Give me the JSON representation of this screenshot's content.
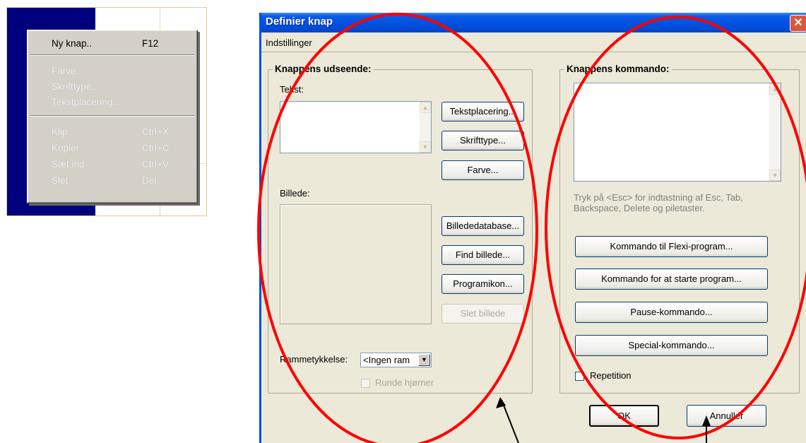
{
  "context_menu": {
    "items": [
      {
        "label": "Ny knap..",
        "accel": "F12",
        "enabled": true
      },
      {
        "label": "Farve...",
        "accel": "",
        "enabled": false
      },
      {
        "label": "Skrifttype...",
        "accel": "",
        "enabled": false
      },
      {
        "label": "Tekstplacering...",
        "accel": "",
        "enabled": false
      },
      {
        "label": "Klip",
        "accel": "Ctrl+X",
        "enabled": false
      },
      {
        "label": "Kopier",
        "accel": "Ctrl+C",
        "enabled": false
      },
      {
        "label": "Sæt ind",
        "accel": "Ctrl+V",
        "enabled": false
      },
      {
        "label": "Slet",
        "accel": "Del",
        "enabled": false
      }
    ]
  },
  "dialog": {
    "title": "Definier knap",
    "close_glyph": "✕",
    "menu": {
      "settings": "Indstillinger"
    },
    "appearance": {
      "group_label": "Knappens udseende:",
      "text_label": "Tekst:",
      "text_value": "",
      "btn_text_placement": "Tekstplacering...",
      "btn_font": "Skrifttype...",
      "btn_color": "Farve...",
      "image_label": "Billede:",
      "btn_image_db": "Billededatabase...",
      "btn_find_image": "Find billede...",
      "btn_program_icon": "Programikon...",
      "btn_delete_image": "Slet billede",
      "frame_label": "Rammetykkelse:",
      "frame_value": "<Ingen ram",
      "rounded_corners": "Runde hjørner"
    },
    "command": {
      "group_label": "Knappens kommando:",
      "command_value": "",
      "hint": "Tryk på <Esc> for indtastning af Esc, Tab, Backspace, Delete og piletaster.",
      "btn_flexi": "Kommando til Flexi-program...",
      "btn_start_program": "Kommando for at starte program...",
      "btn_pause": "Pause-kommando...",
      "btn_special": "Special-kommando...",
      "repetition": "Repetition"
    },
    "ok_label": "OK",
    "cancel_label": "Annuller"
  },
  "annotation_colors": {
    "ellipse": "#ff0000",
    "arrow": "#000000"
  }
}
